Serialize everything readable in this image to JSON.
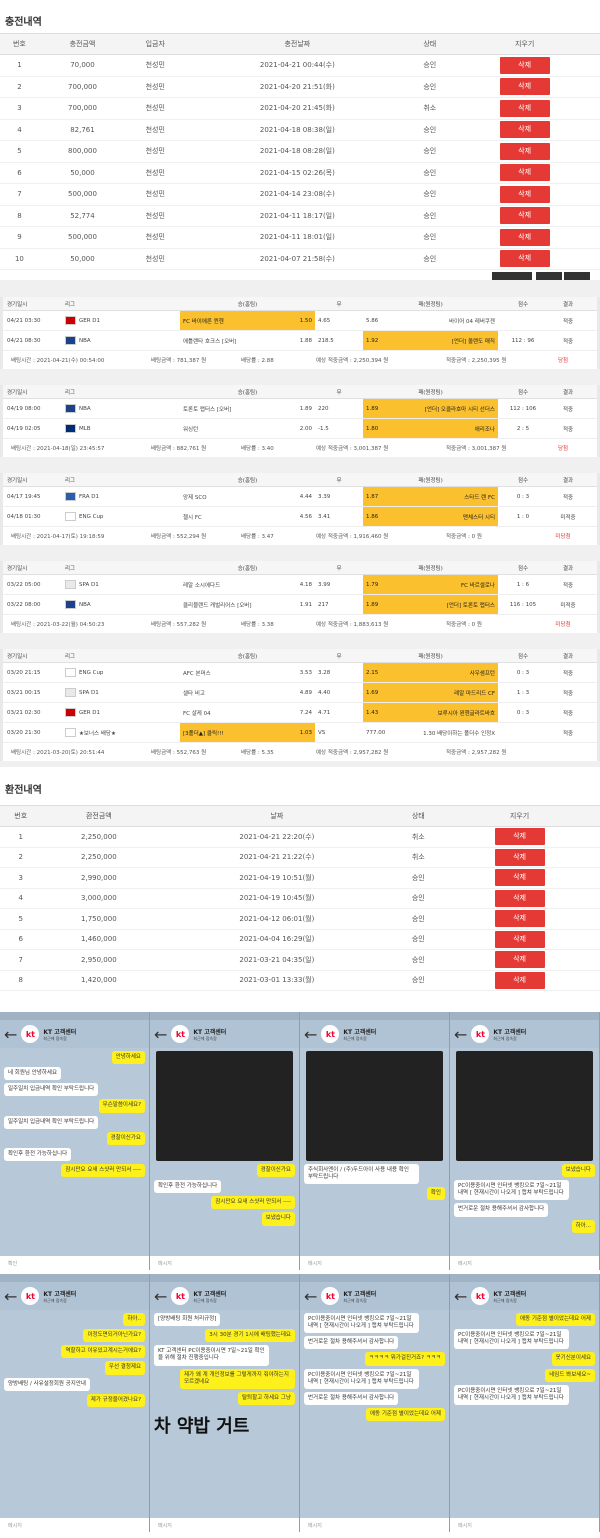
{
  "deposit": {
    "title": "충전내역",
    "headers": [
      "번호",
      "충전금액",
      "입금자",
      "충전날짜",
      "상태",
      "지우기"
    ],
    "rows": [
      [
        "1",
        "70,000",
        "천성민",
        "2021-04-21 00:44(수)",
        "승인"
      ],
      [
        "2",
        "700,000",
        "천성민",
        "2021-04-20 21:51(화)",
        "승인"
      ],
      [
        "3",
        "700,000",
        "천성민",
        "2021-04-20 21:45(화)",
        "취소"
      ],
      [
        "4",
        "82,761",
        "천성민",
        "2021-04-18 08:38(일)",
        "승인"
      ],
      [
        "5",
        "800,000",
        "천성민",
        "2021-04-18 08:28(일)",
        "승인"
      ],
      [
        "6",
        "50,000",
        "천성민",
        "2021-04-15 02:26(목)",
        "승인"
      ],
      [
        "7",
        "500,000",
        "천성민",
        "2021-04-14 23:08(수)",
        "승인"
      ],
      [
        "8",
        "52,774",
        "천성민",
        "2021-04-11 18:17(일)",
        "승인"
      ],
      [
        "9",
        "500,000",
        "천성민",
        "2021-04-11 18:01(일)",
        "승인"
      ],
      [
        "10",
        "50,000",
        "천성민",
        "2021-04-07 21:58(수)",
        "승인"
      ]
    ],
    "delete_label": "삭제"
  },
  "bet_headers": [
    "경기일시",
    "리그",
    "승(홈팀)",
    "무",
    "패(원정팀)",
    "점수",
    "결과"
  ],
  "bets": [
    {
      "matches": [
        {
          "time": "04/21 03:30",
          "league": "GER D1",
          "home": "FC 바이에른 뮌헨",
          "ho": "1.50",
          "draw": "4.65",
          "ao": "5.86",
          "away": "바이어 04 레버쿠젠",
          "score": "",
          "result": "적중",
          "pick": "home"
        },
        {
          "time": "04/21 08:30",
          "league": "NBA",
          "home": "애틀랜타 호크스 [오버]",
          "ho": "1.88",
          "draw": "218.5",
          "ao": "1.92",
          "away": "[언더] 올랜도 매직",
          "score": "112 : 96",
          "result": "적중",
          "pick": "away"
        }
      ],
      "footer": {
        "time": "배팅시간 : 2021-04-21(수) 00:54:00",
        "amount": "배팅금액 : 781,387 원",
        "rate": "배당률 : 2.88",
        "expect": "예상 적중금액 : 2,250,394 원",
        "win": "적중금액 : 2,250,395 원",
        "status": "당첨"
      }
    },
    {
      "matches": [
        {
          "time": "04/19 08:00",
          "league": "NBA",
          "home": "토론토 랩터스 [오버]",
          "ho": "1.89",
          "draw": "220",
          "ao": "1.89",
          "away": "[언더] 오클라호마 시티 선더스",
          "score": "112 : 106",
          "result": "적중",
          "pick": "away"
        },
        {
          "time": "04/19 02:05",
          "league": "MLB",
          "home": "워싱턴",
          "ho": "2.00",
          "draw": "-1.5",
          "ao": "1.80",
          "away": "애리조나",
          "score": "2 : 5",
          "result": "적중",
          "pick": "away"
        }
      ],
      "footer": {
        "time": "배팅시간 : 2021-04-18(일) 23:45:57",
        "amount": "배팅금액 : 882,761 원",
        "rate": "배당률 : 3.40",
        "expect": "예상 적중금액 : 3,001,387 원",
        "win": "적중금액 : 3,001,387 원",
        "status": "당첨"
      }
    },
    {
      "matches": [
        {
          "time": "04/17 19:45",
          "league": "FRA D1",
          "home": "앙제 SCO",
          "ho": "4.44",
          "draw": "3.39",
          "ao": "1.87",
          "away": "스타드 렌 FC",
          "score": "0 : 3",
          "result": "적중",
          "pick": "away"
        },
        {
          "time": "04/18 01:30",
          "league": "ENG Cup",
          "home": "첼시 FC",
          "ho": "4.56",
          "draw": "3.41",
          "ao": "1.86",
          "away": "맨체스터 시티",
          "score": "1 : 0",
          "result": "미적중",
          "pick": "away"
        }
      ],
      "footer": {
        "time": "배팅시간 : 2021-04-17(토) 19:18:59",
        "amount": "배팅금액 : 552,294 원",
        "rate": "배당률 : 3.47",
        "expect": "예상 적중금액 : 1,916,460 원",
        "win": "적중금액 : 0 원",
        "status": "미당첨"
      }
    },
    {
      "matches": [
        {
          "time": "03/22 05:00",
          "league": "SPA D1",
          "home": "레알 소시에다드",
          "ho": "4.18",
          "draw": "3.99",
          "ao": "1.79",
          "away": "FC 바르셀로나",
          "score": "1 : 6",
          "result": "적중",
          "pick": "away"
        },
        {
          "time": "03/22 08:00",
          "league": "NBA",
          "home": "클리블랜드 캐벌리어스 [오버]",
          "ho": "1.91",
          "draw": "217",
          "ao": "1.89",
          "away": "[언더] 토론토 랩터스",
          "score": "116 : 105",
          "result": "미적중",
          "pick": "away"
        }
      ],
      "footer": {
        "time": "배팅시간 : 2021-03-22(월) 04:50:23",
        "amount": "배팅금액 : 557,282 원",
        "rate": "배당률 : 3.38",
        "expect": "예상 적중금액 : 1,883,613 원",
        "win": "적중금액 : 0 원",
        "status": "미당첨"
      }
    },
    {
      "matches": [
        {
          "time": "03/20 21:15",
          "league": "ENG Cup",
          "home": "AFC 본머스",
          "ho": "3.53",
          "draw": "3.28",
          "ao": "2.15",
          "away": "사우샘프턴",
          "score": "0 : 3",
          "result": "적중",
          "pick": "away"
        },
        {
          "time": "03/21 00:15",
          "league": "SPA D1",
          "home": "셀타 비고",
          "ho": "4.89",
          "draw": "4.40",
          "ao": "1.69",
          "away": "레알 마드리드 CF",
          "score": "1 : 3",
          "result": "적중",
          "pick": "away"
        },
        {
          "time": "03/21 02:30",
          "league": "GER D1",
          "home": "FC 샬케 04",
          "ho": "7.24",
          "draw": "4.71",
          "ao": "1.43",
          "away": "보루시아 묀헨글라트바흐",
          "score": "0 : 3",
          "result": "적중",
          "pick": "away"
        },
        {
          "time": "03/20 21:30",
          "league": "★보너스 배당★",
          "home": "[3폴더▲] 클릭!!!",
          "ho": "1.03",
          "draw": "VS",
          "ao": "777.00",
          "away": "1.30 배당이하는 폴더수 인정X",
          "score": "",
          "result": "적중",
          "pick": "home"
        }
      ],
      "footer": {
        "time": "배팅시간 : 2021-03-20(토) 20:51:44",
        "amount": "배팅금액 : 552,763 원",
        "rate": "배당률 : 5.35",
        "expect": "예상 적중금액 : 2,957,282 원",
        "win": "적중금액 : 2,957,282 원",
        "status": ""
      }
    }
  ],
  "withdraw": {
    "title": "환전내역",
    "headers": [
      "번호",
      "환전금액",
      "날짜",
      "상태",
      "지우기"
    ],
    "rows": [
      [
        "1",
        "2,250,000",
        "2021-04-21 22:20(수)",
        "취소"
      ],
      [
        "2",
        "2,250,000",
        "2021-04-21 21:22(수)",
        "취소"
      ],
      [
        "3",
        "2,990,000",
        "2021-04-19 10:51(월)",
        "승인"
      ],
      [
        "4",
        "3,000,000",
        "2021-04-19 10:45(월)",
        "승인"
      ],
      [
        "5",
        "1,750,000",
        "2021-04-12 06:01(월)",
        "승인"
      ],
      [
        "6",
        "1,460,000",
        "2021-04-04 16:29(일)",
        "승인"
      ],
      [
        "7",
        "2,950,000",
        "2021-03-21 04:35(일)",
        "승인"
      ],
      [
        "8",
        "1,420,000",
        "2021-03-01 13:33(월)",
        "승인"
      ]
    ]
  },
  "chat": {
    "name": "KT 고객센터",
    "sub": "최근에 접속함",
    "input": "메시지",
    "p1": [
      [
        "me",
        "안녕하세요"
      ],
      [
        "them",
        "네 회원님 안녕하세요"
      ],
      [
        "them",
        "일주일치 입금내역 확인 부탁드립니다"
      ],
      [
        "me",
        "무슨말씀이세요?"
      ],
      [
        "them",
        "일주일치 입금내역 확인 부탁드립니다"
      ],
      [
        "me",
        "경찰이신가요"
      ],
      [
        "them",
        "확인후 환전 가능하십니다"
      ],
      [
        "me",
        "잠시만요 요새 스샷러 만되서 ----"
      ]
    ],
    "p1_input": "확인",
    "p2": [
      [
        "me",
        "경찰이신가요"
      ],
      [
        "them",
        "확인후 환전 가능하십니다"
      ],
      [
        "me",
        "잠시만요 요새 스샷러 만되서 ----"
      ],
      [
        "me",
        "보냈습니다"
      ]
    ],
    "p3": [
      [
        "them",
        "주식회사엔이 / (주)두드아이 사용 내용 확인 부탁드립니다"
      ],
      [
        "me",
        "확인"
      ]
    ],
    "p4": [
      [
        "me",
        "보냈습니다"
      ],
      [
        "them",
        "PC이용중이시면 인터넷 뱅킹으로 7일~21일 내역 [ 현재시간이 나오게 ] 캡쳐 부탁드립니다"
      ],
      [
        "them",
        "번거로운 절차 용해주셔서 감사합니다"
      ],
      [
        "me",
        "하아..."
      ]
    ],
    "p5": [
      [
        "me",
        "하아.."
      ],
      [
        "me",
        "이정도면되거아닌가요?"
      ],
      [
        "me",
        "역할하고 이유있고계시는거에요?"
      ],
      [
        "me",
        "우선 결청제요"
      ],
      [
        "them",
        "양방배팅 / 사유설정회원 공지안내"
      ],
      [
        "me",
        "제가 규정을어겼나요?"
      ]
    ],
    "p6": [
      [
        "them",
        "[양방배팅 회원 처리규정]"
      ],
      [
        "me",
        "3시 30분 경기 1시에 배팅했는데요"
      ],
      [
        "them",
        "KT 고객센터 PC이용중이시면 7일~21일 확인을 위해 절차 진행중입니다"
      ],
      [
        "me",
        "제가 왜 계 개인정보를 그렇게까지 줘야하는지 모르겠네요"
      ],
      [
        "me",
        "탈퇴할고 하세요 그냥"
      ]
    ],
    "p6_big": "차 약밥 거트",
    "p7": [
      [
        "them",
        "PC이용중이시면 인터넷 뱅킹으로 7일~21일 내역 [ 현재시간이 나오게 ] 캡쳐 부탁드립니다"
      ],
      [
        "them",
        "번거로운 절차 용해주셔서 감사합니다"
      ],
      [
        "me",
        "ㅋㅋㅋㅋ 뭐가걸진거죠? ㅋㅋㅋ"
      ],
      [
        "them",
        "PC이용중이시면 인터넷 뱅킹으로 7일~21일 내역 [ 현재시간이 나오게 ] 캡쳐 부탁드립니다"
      ],
      [
        "them",
        "번거로운 절차 용해주셔서 감사합니다"
      ],
      [
        "me",
        "애동 기준점 별이었는데요 어제"
      ]
    ],
    "p8": [
      [
        "me",
        "애동 기준점 별이었는데요 어제"
      ],
      [
        "them",
        "PC이용중이시면 인터넷 뱅킹으로 7일~21일 내역 [ 현재시간이 나오게 ] 캡쳐 부탁드립니다"
      ],
      [
        "me",
        "옷기신분이세요"
      ],
      [
        "me",
        "네임드 봐보세요~"
      ],
      [
        "them",
        "PC이용중이시면 인터넷 뱅킹으로 7일~21일 내역 [ 현재시간이 나오게 ] 캡쳐 부탁드립니다"
      ]
    ]
  }
}
